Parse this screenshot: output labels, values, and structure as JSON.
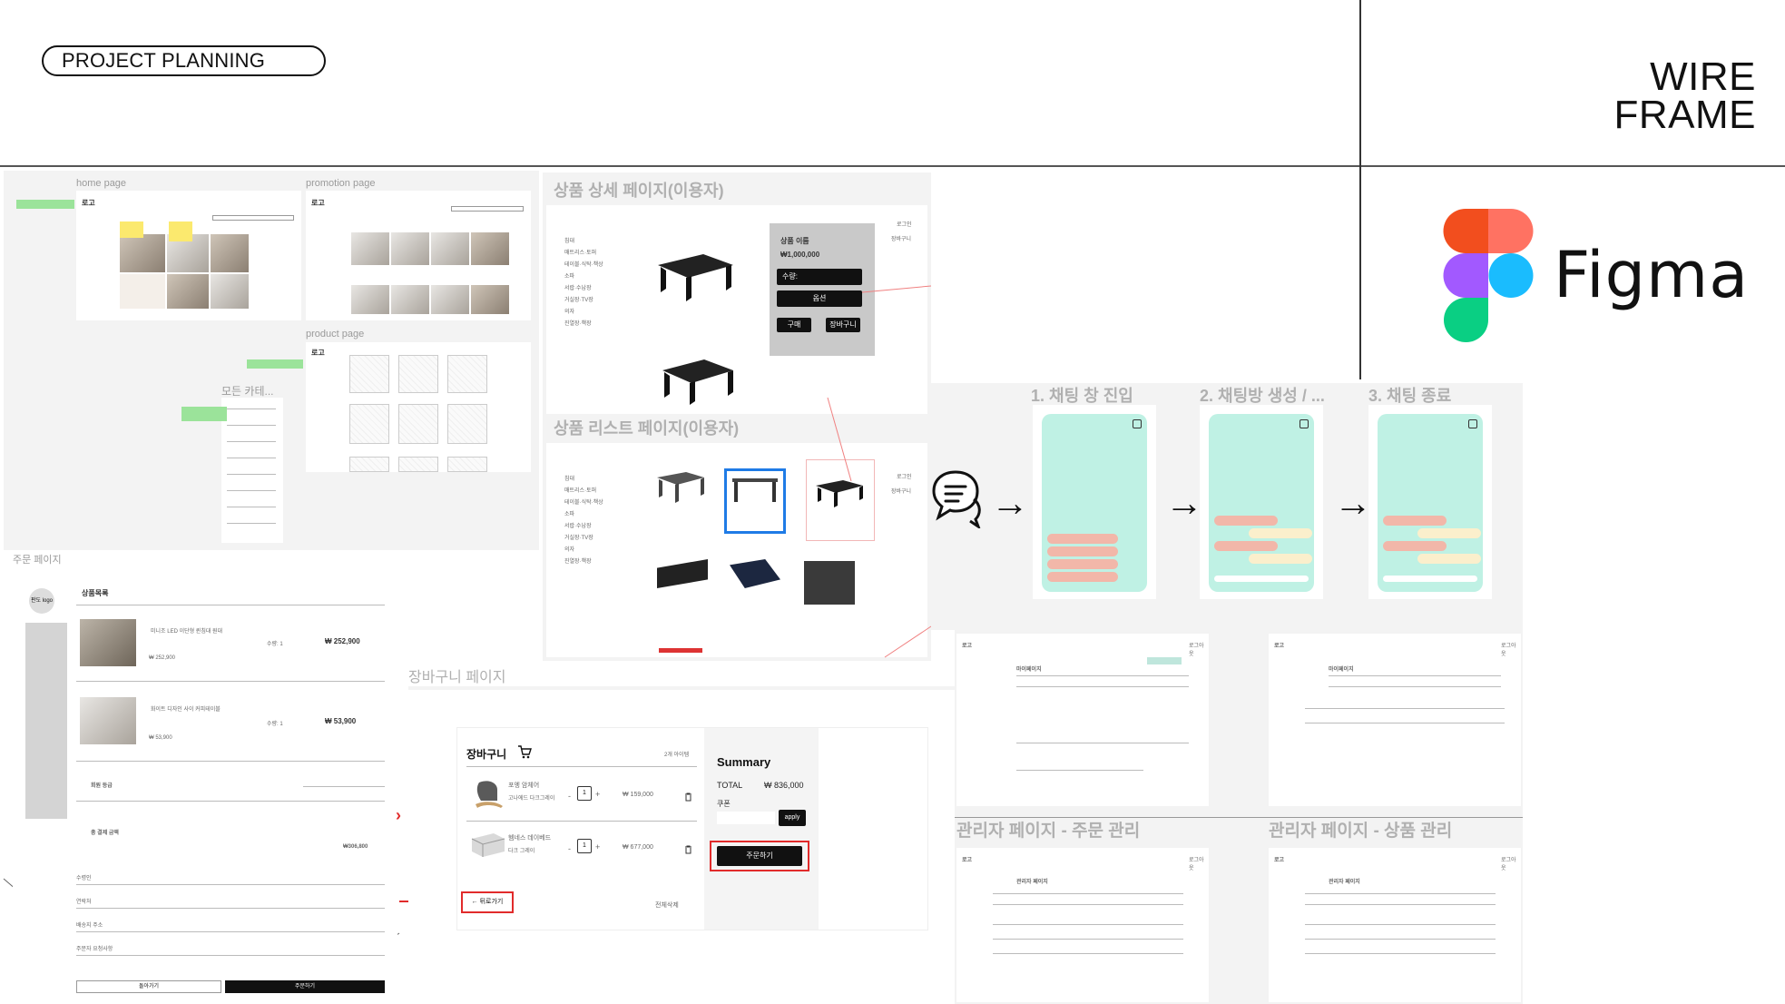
{
  "header": {
    "pill": "PROJECT PLANNING",
    "title_line1": "WIRE",
    "title_line2": "FRAME",
    "brand": "Figma"
  },
  "colors": {
    "figma_red": "#f24e1e",
    "figma_orange": "#ff7262",
    "figma_purple": "#a259ff",
    "figma_blue": "#1abcfe",
    "figma_green": "#0acf83",
    "chat_mint": "#bff1e4",
    "bubble_pink": "#f2b7a9",
    "bubble_cream": "#fbefcc",
    "highlight_red": "#e12b2b",
    "selection_blue": "#1f7be6"
  },
  "frames": {
    "home": "home page",
    "promotion": "promotion page",
    "product": "product page",
    "all_category": "모든 카테...",
    "detail": "상품 상세 페이지(이용자)",
    "list": "상품 리스트 페이지(이용자)",
    "chat1": "1. 채팅 창 진입",
    "chat2": "2. 채팅방 생성 / ...",
    "chat3": "3. 채팅 종료",
    "order": "주문 페이지",
    "cart_page": "장바구니 페이지",
    "admin_order": "관리자 페이지 - 주문 관리",
    "admin_product": "관리자 페이지 - 상품 관리"
  },
  "product_detail": {
    "name": "상품 이름",
    "price": "₩1,000,000",
    "qty": "수량:",
    "option": "옵션",
    "buy": "구매",
    "cart": "장바구니",
    "login": "로그인",
    "cart_link": "장바구니"
  },
  "categories": [
    "침대",
    "매트리스·토퍼",
    "테이블·식탁·책상",
    "소파",
    "서랍·수납장",
    "거실장·TV장",
    "의자",
    "진열장·책장"
  ],
  "order_page": {
    "logo": "판도 logo",
    "section": "상품목록",
    "item1_name": "미니조 LED 이단형 퀸침대 원대",
    "item1_qty": "수량: 1",
    "item1_price": "₩ 252,900",
    "item1_sub": "₩ 252,900",
    "item2_name": "화이트 디자인 사이 커피테이블",
    "item2_qty": "수량: 1",
    "item2_price": "₩ 53,900",
    "item2_sub": "₩ 53,900",
    "grade": "회원 등급",
    "total_label": "총 결제 금액",
    "total": "₩306,800",
    "fields": [
      "수령인",
      "연락처",
      "배송지 주소",
      "주문자 요청사항"
    ],
    "back": "돌아가기",
    "order_btn": "주문하기"
  },
  "cart": {
    "title": "장바구니",
    "count": "2개 아이템",
    "item1_name": "포엥 암체어",
    "item1_sub": "고나에드 다크그레이",
    "item1_price": "₩ 159,000",
    "item1_qty": "1",
    "item2_name": "헴네스 데이베드",
    "item2_sub": "다크 그레이",
    "item2_price": "₩ 677,000",
    "item2_qty": "1",
    "back": "← 뒤로가기",
    "clear": "전체삭제",
    "summary": "Summary",
    "total_label": "TOTAL",
    "total": "₩ 836,000",
    "coupon": "쿠폰",
    "apply": "apply",
    "checkout": "주문하기"
  },
  "mypage": {
    "logo": "로고",
    "title": "마이페이지",
    "logout": "로그아웃"
  },
  "admin": {
    "logo": "로고",
    "title": "관리자 페이지",
    "logout": "로그아웃"
  }
}
